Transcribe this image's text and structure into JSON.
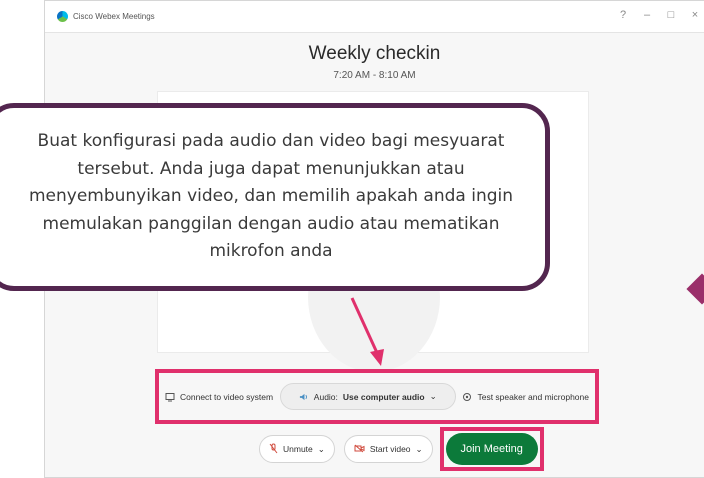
{
  "window": {
    "app_title": "Cisco Webex Meetings",
    "controls": {
      "help": "?",
      "minimize": "–",
      "maximize": "□",
      "close": "×"
    }
  },
  "meeting": {
    "title": "Weekly checkin",
    "time": "7:20 AM - 8:10 AM"
  },
  "options": {
    "connect_video": "Connect to video system",
    "audio_label": "Audio:",
    "audio_value": "Use computer audio",
    "test_speaker": "Test speaker and microphone"
  },
  "controls": {
    "unmute": "Unmute",
    "start_video": "Start video",
    "join": "Join Meeting"
  },
  "callout": {
    "text": "Buat konfigurasi pada audio dan video bagi mesyuarat tersebut. Anda juga dapat menunjukkan atau menyembunyikan video, dan memilih apakah anda ingin memulakan panggilan dengan audio atau mematikan mikrofon anda"
  },
  "colors": {
    "highlight": "#e0306c",
    "callout_border": "#53264f",
    "join_button": "#0c7a3a"
  },
  "icons": [
    "webex-logo-icon",
    "help-icon",
    "minimize-icon",
    "maximize-icon",
    "close-icon",
    "video-system-icon",
    "audio-icon",
    "chevron-down-icon",
    "speaker-test-icon",
    "microphone-muted-icon",
    "video-muted-icon"
  ]
}
